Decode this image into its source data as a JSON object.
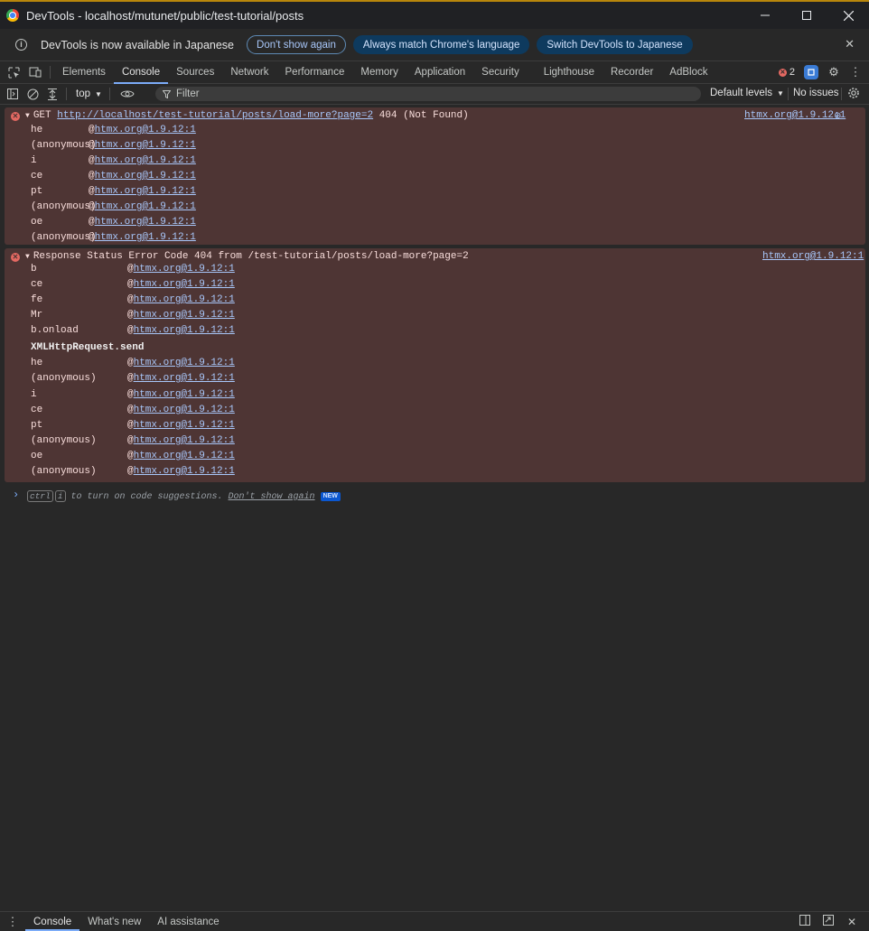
{
  "window": {
    "title": "DevTools - localhost/mutunet/public/test-tutorial/posts"
  },
  "infobar": {
    "message": "DevTools is now available in Japanese",
    "dont_show": "Don't show again",
    "always_match": "Always match Chrome's language",
    "switch": "Switch DevTools to Japanese"
  },
  "tabs": [
    "Elements",
    "Console",
    "Sources",
    "Network",
    "Performance",
    "Memory",
    "Application",
    "Security",
    "Lighthouse",
    "Recorder",
    "AdBlock"
  ],
  "active_tab": "Console",
  "error_count": "2",
  "toolbar": {
    "context": "top",
    "filter_placeholder": "Filter",
    "levels": "Default levels",
    "issues": "No issues"
  },
  "messages": {
    "m1": {
      "method": "GET",
      "url": "http://localhost/test-tutorial/posts/load-more?page=2",
      "status": "404 (Not Found)",
      "source": "htmx.org@1.9.12:1",
      "stack": [
        {
          "fn": "he",
          "src": "htmx.org@1.9.12:1"
        },
        {
          "fn": "(anonymous)",
          "src": "htmx.org@1.9.12:1"
        },
        {
          "fn": "i",
          "src": "htmx.org@1.9.12:1"
        },
        {
          "fn": "ce",
          "src": "htmx.org@1.9.12:1"
        },
        {
          "fn": "pt",
          "src": "htmx.org@1.9.12:1"
        },
        {
          "fn": "(anonymous)",
          "src": "htmx.org@1.9.12:1"
        },
        {
          "fn": "oe",
          "src": "htmx.org@1.9.12:1"
        },
        {
          "fn": "(anonymous)",
          "src": "htmx.org@1.9.12:1"
        }
      ]
    },
    "m2": {
      "text": "Response Status Error Code 404 from /test-tutorial/posts/load-more?page=2",
      "source": "htmx.org@1.9.12:1",
      "stack_a": [
        {
          "fn": "b",
          "src": "htmx.org@1.9.12:1"
        },
        {
          "fn": "ce",
          "src": "htmx.org@1.9.12:1"
        },
        {
          "fn": "fe",
          "src": "htmx.org@1.9.12:1"
        },
        {
          "fn": "Mr",
          "src": "htmx.org@1.9.12:1"
        },
        {
          "fn": "b.onload",
          "src": "htmx.org@1.9.12:1"
        }
      ],
      "async_label": "XMLHttpRequest.send",
      "stack_b": [
        {
          "fn": "he",
          "src": "htmx.org@1.9.12:1"
        },
        {
          "fn": "(anonymous)",
          "src": "htmx.org@1.9.12:1"
        },
        {
          "fn": "i",
          "src": "htmx.org@1.9.12:1"
        },
        {
          "fn": "ce",
          "src": "htmx.org@1.9.12:1"
        },
        {
          "fn": "pt",
          "src": "htmx.org@1.9.12:1"
        },
        {
          "fn": "(anonymous)",
          "src": "htmx.org@1.9.12:1"
        },
        {
          "fn": "oe",
          "src": "htmx.org@1.9.12:1"
        },
        {
          "fn": "(anonymous)",
          "src": "htmx.org@1.9.12:1"
        }
      ]
    }
  },
  "prompt": {
    "key1": "ctrl",
    "key2": "i",
    "text": " to turn on code suggestions. ",
    "dont_show": "Don't show again",
    "badge": "NEW"
  },
  "drawer": {
    "tabs": [
      "Console",
      "What's new",
      "AI assistance"
    ],
    "active": "Console"
  },
  "colors": {
    "error_bg": "#4e3534",
    "error_icon": "#e46962",
    "link": "#a8c7fa",
    "accent": "#7cacf8"
  }
}
